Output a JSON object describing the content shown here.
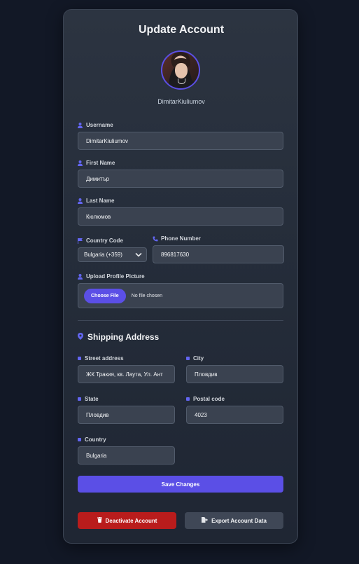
{
  "page": {
    "title": "Update Account"
  },
  "profile": {
    "display_name": "DimitarKiuliumov"
  },
  "form": {
    "username": {
      "label": "Username",
      "value": "DimitarKiuliumov"
    },
    "first_name": {
      "label": "First Name",
      "value": "Димитър"
    },
    "last_name": {
      "label": "Last Name",
      "value": "Кюлюмов"
    },
    "country_code": {
      "label": "Country Code",
      "value": "Bulgaria (+359)"
    },
    "phone": {
      "label": "Phone Number",
      "value": "896817630"
    },
    "upload": {
      "label": "Upload Profile Picture",
      "button": "Choose File",
      "status": "No file chosen"
    }
  },
  "shipping": {
    "title": "Shipping Address",
    "street": {
      "label": "Street address",
      "value": "ЖК Тракия, кв. Лаута, Ул. Ант"
    },
    "city": {
      "label": "City",
      "value": "Пловдив"
    },
    "state": {
      "label": "State",
      "value": "Пловдив"
    },
    "postal": {
      "label": "Postal code",
      "value": "4023"
    },
    "country": {
      "label": "Country",
      "value": "Bulgaria"
    }
  },
  "actions": {
    "save": "Save Changes",
    "deactivate": "Deactivate Account",
    "export": "Export Account Data"
  },
  "colors": {
    "accent": "#5b4fe6",
    "danger": "#b91c1c",
    "background": "#121826",
    "card": "#2a3240"
  },
  "icons": {
    "username": "user-icon",
    "country_code": "flag-icon",
    "phone": "phone-icon",
    "upload": "user-upload-icon",
    "shipping": "map-pin-icon",
    "deactivate": "trash-icon",
    "export": "file-export-icon"
  }
}
